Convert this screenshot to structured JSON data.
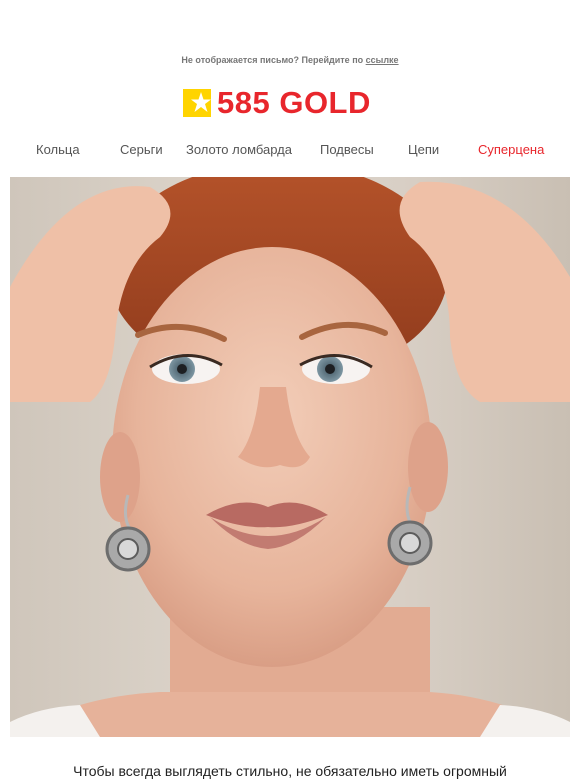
{
  "preheader": {
    "text": "Не отображается письмо? Перейдите по",
    "link_label": "ссылке"
  },
  "logo": {
    "text": "585 GOLD",
    "brand_color": "#e8262c",
    "mark_color": "#ffd400"
  },
  "nav": {
    "items": [
      {
        "label": "Кольца"
      },
      {
        "label": "Серьги"
      },
      {
        "label": "Золото ломбарда"
      },
      {
        "label": "Подвесы"
      },
      {
        "label": "Цепи"
      },
      {
        "label": "Суперцена"
      }
    ],
    "highlight_color": "#e8262c"
  },
  "intro": {
    "text": "Чтобы всегда выглядеть стильно, не обязательно иметь огромный"
  }
}
